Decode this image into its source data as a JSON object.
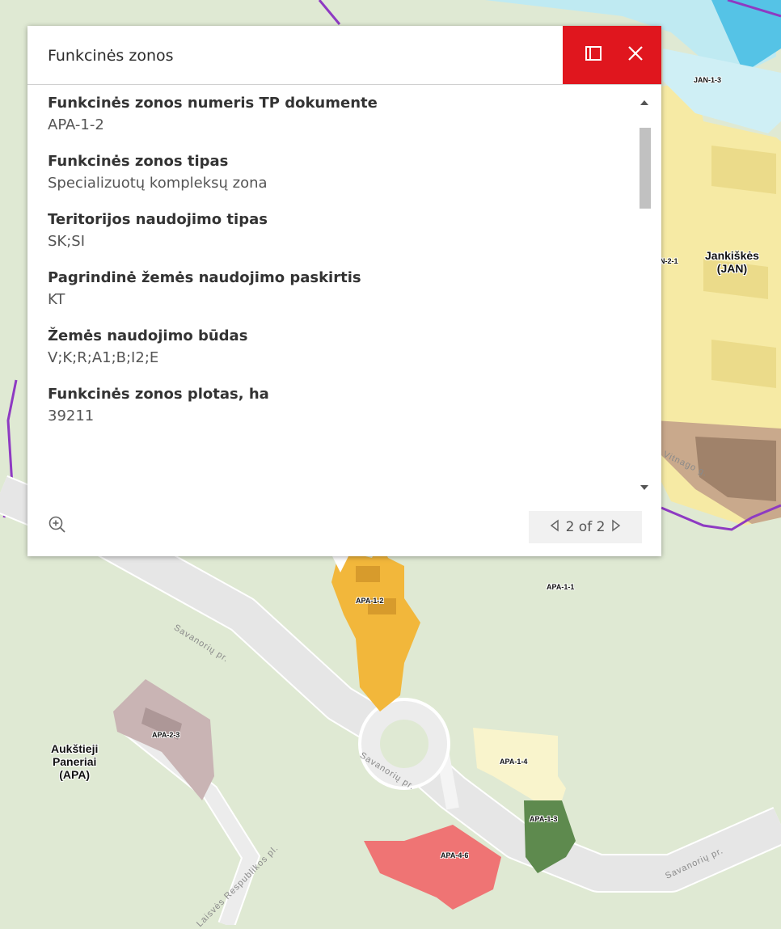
{
  "popup": {
    "title": "Funkcinės zonos",
    "fields": [
      {
        "label": "Funkcinės zonos numeris TP dokumente",
        "value": "APA-1-2"
      },
      {
        "label": "Funkcinės zonos tipas",
        "value": "Specializuotų kompleksų zona"
      },
      {
        "label": "Teritorijos naudojimo tipas",
        "value": "SK;SI"
      },
      {
        "label": "Pagrindinė žemės naudojimo paskirtis",
        "value": "KT"
      },
      {
        "label": "Žemės naudojimo būdas",
        "value": "V;K;R;A1;B;I2;E"
      },
      {
        "label": "Funkcinės zonos plotas, ha",
        "value": "39211"
      }
    ],
    "pager": "2 of 2",
    "icons": {
      "dock": "dock-icon",
      "close": "close-icon",
      "zoom": "zoom-in-icon",
      "prev": "previous-icon",
      "next": "next-icon"
    },
    "accent": "#e0161e"
  },
  "map": {
    "zones": [
      "APA-1-2",
      "APA-1-1",
      "APA-2-3",
      "APA-1-4",
      "APA-1-3",
      "APA-4-6",
      "JAN-1-3",
      "N-2-1"
    ],
    "areas": {
      "jankiskes": [
        "Jankiškės",
        "(JAN)"
      ],
      "paneriai": [
        "Aukštieji",
        "Paneriai",
        "(APA)"
      ]
    },
    "streets": [
      "Savanorių pr.",
      "Savanorių pr.",
      "Savanorių pr.",
      "Laisvės Respublikos pl.",
      "Vitnago g."
    ],
    "colors": {
      "yellow_zone": "#f6eaa4",
      "orange_zone": "#f2b73b",
      "red_zone": "#ef7474",
      "mauve_zone": "#c9b4b4",
      "dark_green_zone": "#5e8a4e",
      "light_zone": "#f9f4cc",
      "water": "#bfeaf2",
      "boundary": "#8e3ac2"
    }
  }
}
